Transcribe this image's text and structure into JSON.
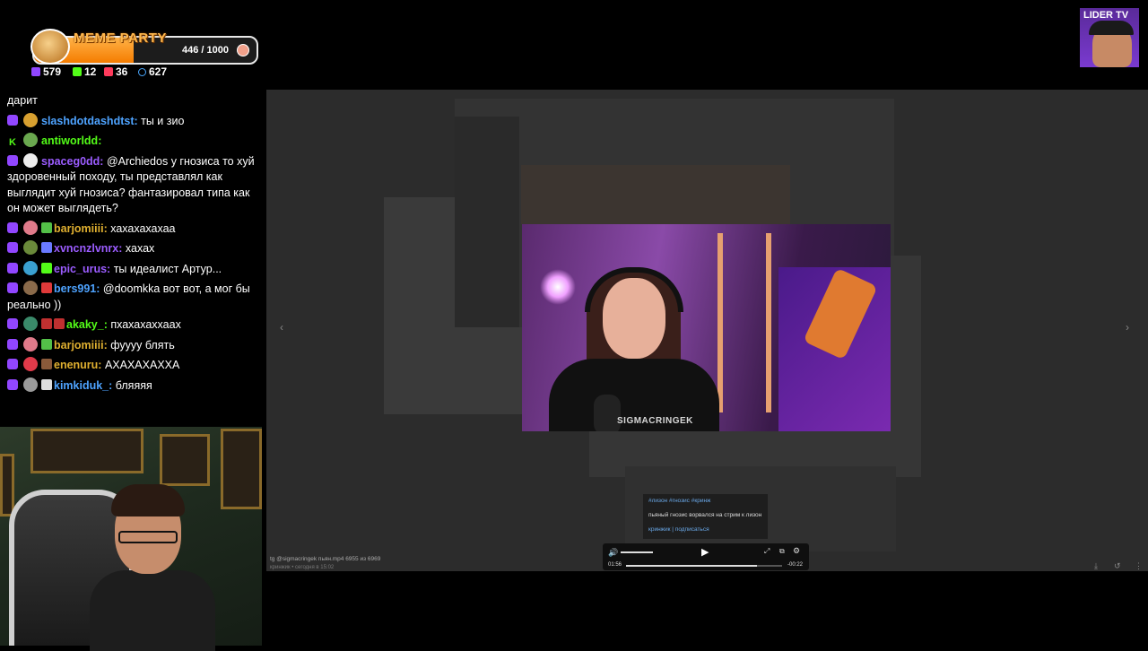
{
  "overlay": {
    "title": "MEME PARTY",
    "progress_current": 446,
    "progress_max": 1000,
    "progress_text": "446 / 1000",
    "progress_fraction": 0.446,
    "stats": [
      {
        "icon": "twitch-icon",
        "value": "579",
        "color": "#9146ff"
      },
      {
        "icon": "kick-icon",
        "value": "12",
        "color": "#53fc18"
      },
      {
        "icon": "vk-live-icon",
        "value": "36",
        "color": "#ff3b5c"
      },
      {
        "icon": "viewers-icon",
        "value": "627",
        "color": "#4aa8ff"
      }
    ]
  },
  "chat": {
    "messages": [
      {
        "platform": "twitch",
        "nick": "",
        "text": "дарит",
        "nick_color": "#ffffff"
      },
      {
        "platform": "twitch",
        "nick": "slashdotdashdtst:",
        "text": " ты и зио",
        "nick_color": "#4ea3ff"
      },
      {
        "platform": "kick",
        "nick": "antiworldd:",
        "text": "",
        "nick_color": "#53fc18"
      },
      {
        "platform": "twitch",
        "nick": "spaceg0dd:",
        "text": " @Archiedos у гнозиса то хуй здоровенный походу, ты представлял как выглядит хуй гнозиса? фантазировал типа как он может выглядеть?",
        "nick_color": "#9b5cff"
      },
      {
        "platform": "twitch",
        "nick": "barjomiiii:",
        "text": " хахахахахаа",
        "nick_color": "#e0b030"
      },
      {
        "platform": "twitch",
        "nick": "xvncnzlvnrx:",
        "text": " хахах",
        "nick_color": "#9b5cff"
      },
      {
        "platform": "twitch",
        "nick": "epic_urus:",
        "text": " ты идеалист Артур...",
        "nick_color": "#9b5cff"
      },
      {
        "platform": "twitch",
        "nick": "bers991:",
        "text": " @doomkka вот вот, а мог бы реально ))",
        "nick_color": "#4ea3ff"
      },
      {
        "platform": "twitch",
        "nick": "akaky_:",
        "text": " пхахахаххаах",
        "nick_color": "#53fc18"
      },
      {
        "platform": "twitch",
        "nick": "barjomiiii:",
        "text": " фуууу блять",
        "nick_color": "#e0b030"
      },
      {
        "platform": "twitch",
        "nick": "enenuru:",
        "text": " АХАХАХАХХА",
        "nick_color": "#e0b030"
      },
      {
        "platform": "twitch",
        "nick": "kimkiduk_:",
        "text": " бляяяя",
        "nick_color": "#4ea3ff"
      }
    ]
  },
  "video": {
    "watermark": "SIGMACRINGEK",
    "caption_tags": "#лизон #гнозис #кринж",
    "caption_text": "пьяный гнозис ворвался на стрим к лизон",
    "caption_link": "кринжик | подписаться",
    "time_current": "01:56",
    "time_remaining": "-00:22",
    "progress_fraction": 0.84,
    "file_line": "tg @sigmacringek пьян.mp4 6955 из 6969",
    "file_line2": "кринжик • сегодня в 15:02"
  },
  "logo": {
    "text": "LIDER TV"
  }
}
